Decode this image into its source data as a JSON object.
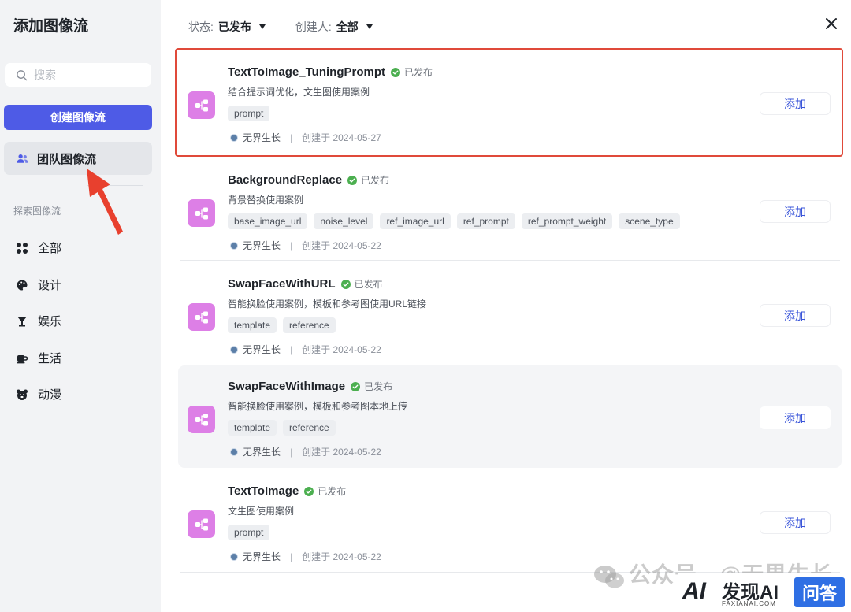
{
  "sidebar": {
    "title": "添加图像流",
    "search_placeholder": "搜索",
    "create_button": "创建图像流",
    "team_item": "团队图像流",
    "section_label": "探索图像流",
    "nav": [
      {
        "label": "全部",
        "icon": "grid-icon"
      },
      {
        "label": "设计",
        "icon": "palette-icon"
      },
      {
        "label": "娱乐",
        "icon": "cocktail-icon"
      },
      {
        "label": "生活",
        "icon": "coffee-cup-icon"
      },
      {
        "label": "动漫",
        "icon": "bear-face-icon"
      }
    ]
  },
  "filters": {
    "status_label": "状态:",
    "status_value": "已发布",
    "creator_label": "创建人:",
    "creator_value": "全部"
  },
  "cards": [
    {
      "name": "TextToImage_TuningPrompt",
      "status": "已发布",
      "desc": "结合提示词优化，文生图使用案例",
      "tags": [
        "prompt"
      ],
      "author": "无界生长",
      "sep": "|",
      "created": "创建于 2024-05-27",
      "add": "添加"
    },
    {
      "name": "BackgroundReplace",
      "status": "已发布",
      "desc": "背景替换使用案例",
      "tags": [
        "base_image_url",
        "noise_level",
        "ref_image_url",
        "ref_prompt",
        "ref_prompt_weight",
        "scene_type"
      ],
      "author": "无界生长",
      "sep": "|",
      "created": "创建于 2024-05-22",
      "add": "添加"
    },
    {
      "name": "SwapFaceWithURL",
      "status": "已发布",
      "desc": "智能换脸使用案例，模板和参考图使用URL链接",
      "tags": [
        "template",
        "reference"
      ],
      "author": "无界生长",
      "sep": "|",
      "created": "创建于 2024-05-22",
      "add": "添加"
    },
    {
      "name": "SwapFaceWithImage",
      "status": "已发布",
      "desc": "智能换脸使用案例，模板和参考图本地上传",
      "tags": [
        "template",
        "reference"
      ],
      "author": "无界生长",
      "sep": "|",
      "created": "创建于 2024-05-22",
      "add": "添加"
    },
    {
      "name": "TextToImage",
      "status": "已发布",
      "desc": "文生图使用案例",
      "tags": [
        "prompt"
      ],
      "author": "无界生长",
      "sep": "|",
      "created": "创建于 2024-05-22",
      "add": "添加"
    }
  ],
  "watermark": {
    "text": "公众号 · @无界生长",
    "brand_ai": "AI",
    "brand_name": "发现AI",
    "brand_sub": "FAXIANAI.COM",
    "brand_qa": "问答"
  },
  "colors": {
    "accent": "#4e5be6",
    "flow_icon_bg": "#dd7fe6",
    "published_green": "#4caf50",
    "highlight_border": "#e04a3a",
    "arrow_red": "#e8402e"
  }
}
